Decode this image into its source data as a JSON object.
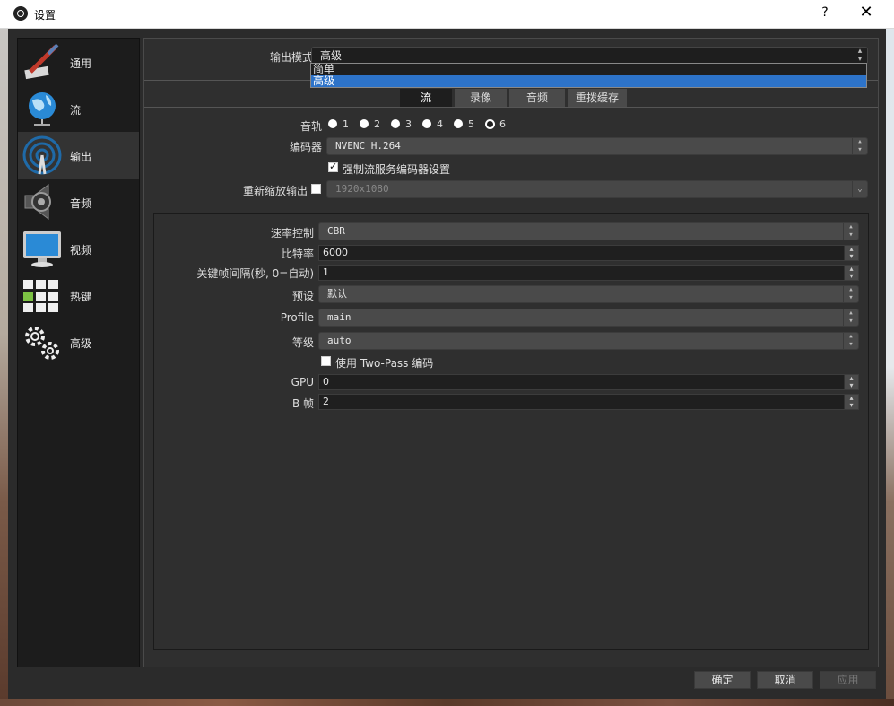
{
  "window": {
    "title": "设置",
    "help": "?",
    "close": "✕"
  },
  "sidebar": {
    "items": [
      {
        "label": "通用",
        "icon": "general-icon"
      },
      {
        "label": "流",
        "icon": "stream-globe-icon"
      },
      {
        "label": "输出",
        "icon": "output-antenna-icon",
        "active": true
      },
      {
        "label": "音频",
        "icon": "speaker-icon"
      },
      {
        "label": "视频",
        "icon": "monitor-icon"
      },
      {
        "label": "热键",
        "icon": "keyboard-icon"
      },
      {
        "label": "高级",
        "icon": "gears-icon"
      }
    ]
  },
  "output_mode": {
    "label": "输出模式",
    "value": "高级",
    "options": [
      "简单",
      "高级"
    ],
    "selected_index": 1
  },
  "tabs": [
    {
      "label": "流",
      "active": true
    },
    {
      "label": "录像"
    },
    {
      "label": "音频"
    },
    {
      "label": "重拨缓存"
    }
  ],
  "stream": {
    "audio_track_label": "音轨",
    "tracks": [
      "1",
      "2",
      "3",
      "4",
      "5",
      "6"
    ],
    "selected_track": "6",
    "encoder_label": "编码器",
    "encoder_value": "NVENC H.264",
    "enforce_label": "强制流服务编码器设置",
    "enforce_checked": true,
    "rescale_label": "重新缩放输出",
    "rescale_checked": false,
    "rescale_value": "1920x1080"
  },
  "encoder_settings": {
    "rate_control_label": "速率控制",
    "rate_control": "CBR",
    "bitrate_label": "比特率",
    "bitrate": "6000",
    "keyframe_label": "关键帧间隔(秒, 0=自动)",
    "keyframe": "1",
    "preset_label": "预设",
    "preset": "默认",
    "profile_label": "Profile",
    "profile": "main",
    "level_label": "等级",
    "level": "auto",
    "two_pass_label": "使用 Two-Pass 编码",
    "two_pass_checked": false,
    "gpu_label": "GPU",
    "gpu": "0",
    "bframes_label": "B 帧",
    "bframes": "2"
  },
  "footer": {
    "ok": "确定",
    "cancel": "取消",
    "apply": "应用"
  },
  "colors": {
    "accent": "#2d73c9",
    "window_bg": "#2b2b2b",
    "panel_bg": "#2f2f2f",
    "sidebar_bg": "#1c1c1c"
  }
}
